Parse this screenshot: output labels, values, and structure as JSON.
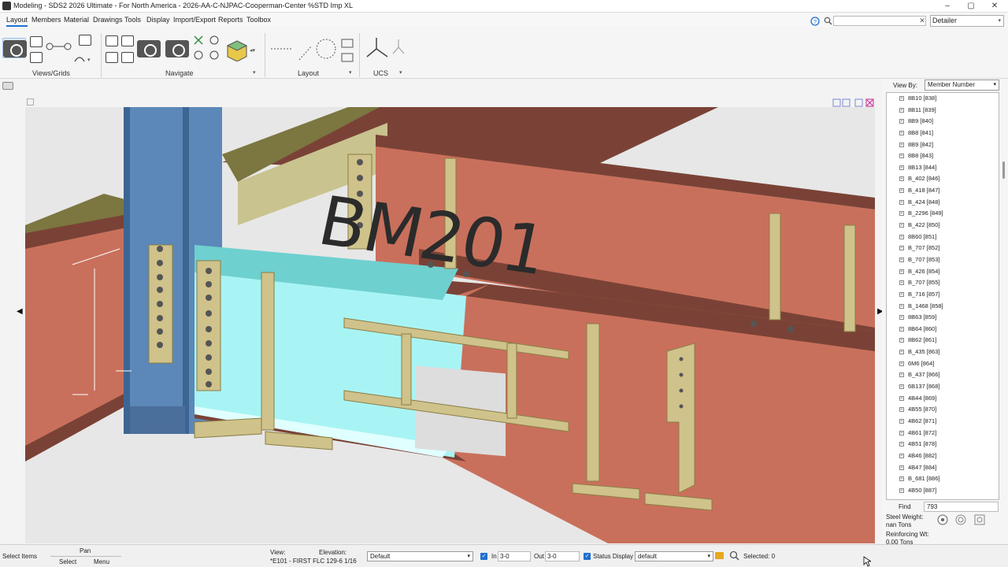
{
  "window": {
    "title": "Modeling - SDS2 2026 Ultimate - For North America - 2026-AA-C-NJPAC-Cooperman-Center %STD Imp XL",
    "minimize_glyph": "–",
    "maximize_glyph": "▢",
    "close_glyph": "✕"
  },
  "menu": {
    "items": [
      "Layout",
      "Members",
      "Material",
      "Drawings",
      "Tools",
      "Display",
      "Import/Export",
      "Reports",
      "Toolbox"
    ],
    "active": "Layout"
  },
  "search": {
    "value": "",
    "clear_glyph": "✕"
  },
  "role_select": {
    "value": "Detailer"
  },
  "ribbon": {
    "groups": [
      {
        "label": "Views/Grids"
      },
      {
        "label": "Navigate"
      },
      {
        "label": "Layout"
      },
      {
        "label": "UCS"
      }
    ]
  },
  "viewport": {
    "model_label": "BM201",
    "colors": {
      "beam_red": "#c9705c",
      "beam_dark": "#7a4236",
      "column_blue": "#5b88b8",
      "plate_gold": "#cfc28a",
      "plate_dark": "#8a7d45",
      "deck_olive": "#7c7640",
      "selection_cyan": "#a8f4f4"
    }
  },
  "panel": {
    "view_by_label": "View By:",
    "view_by_value": "Member Number",
    "members": [
      "8B10 [838]",
      "8B11 [839]",
      "8B9 [840]",
      "8B8 [841]",
      "8B9 [842]",
      "8B8 [843]",
      "8B13 [844]",
      "B_402 [846]",
      "B_418 [847]",
      "B_424 [848]",
      "B_2296 [849]",
      "B_422 [850]",
      "8B60 [851]",
      "B_707 [852]",
      "B_707 [853]",
      "B_426 [854]",
      "B_707 [855]",
      "B_716 [857]",
      "B_1468 [858]",
      "8B63 [859]",
      "8B64 [860]",
      "8B62 [861]",
      "B_435 [863]",
      "6M6 [864]",
      "B_437 [866]",
      "6B137 [868]",
      "4B44 [869]",
      "4B55 [870]",
      "4B62 [871]",
      "4B61 [872]",
      "4B51 [878]",
      "4B46 [882]",
      "4B47 [884]",
      "B_681 [886]",
      "4B50 [887]"
    ],
    "find_label": "Find",
    "find_value": "793",
    "steel_weight_label": "Steel Weight:",
    "steel_weight_value": "nan Tons",
    "reinforcing_label": "Reinforcing Wt:",
    "reinforcing_value": "0.00 Tons"
  },
  "status": {
    "select_items": "Select Items",
    "pan": "Pan",
    "select": "Select",
    "menu": "Menu",
    "view_label": "View:",
    "view_value": "*E101 - FIRST FLC 129-6 1/16",
    "elevation_label": "Elevation:",
    "elevation_select": "Default",
    "in_label": "In",
    "in_value": "3-0",
    "out_label": "Out",
    "out_value": "3-0",
    "status_display_label": "Status Display",
    "status_display_value": "default",
    "selected": "Selected: 0"
  }
}
